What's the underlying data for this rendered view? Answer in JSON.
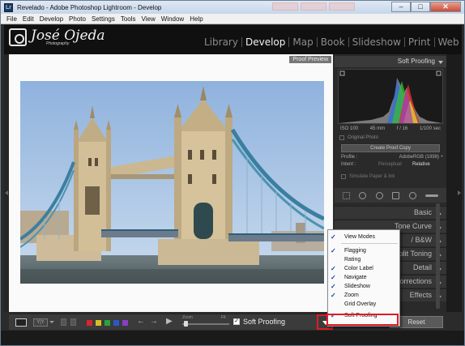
{
  "window": {
    "title": "Revelado - Adobe Photoshop Lightroom - Develop",
    "app_icon": "Lr",
    "minimize": "–",
    "maximize": "□",
    "close": "✕"
  },
  "menu": [
    "File",
    "Edit",
    "Develop",
    "Photo",
    "Settings",
    "Tools",
    "View",
    "Window",
    "Help"
  ],
  "identity": {
    "name": "José Ojeda",
    "sub": "Photography"
  },
  "modules": [
    "Library",
    "Develop",
    "Map",
    "Book",
    "Slideshow",
    "Print",
    "Web"
  ],
  "active_module": "Develop",
  "view": {
    "proof_label": "Proof Preview"
  },
  "right_panel": {
    "header": "Soft Proofing",
    "exif": [
      "ISO 100",
      "45 mm",
      "f / 16",
      "1/100 sec"
    ],
    "original_photo": "Original Photo",
    "create_button": "Create Proof Copy",
    "profile_label": "Profile :",
    "profile_value": "AdobeRGB (1998) ÷",
    "intent_label": "Intent :",
    "intent_perceptual": "Perceptual",
    "intent_relative": "Relative",
    "simulate": "Simulate Paper & Ink",
    "panels": [
      "Basic",
      "Tone Curve",
      "/ B&W",
      "Split Toning",
      "Detail",
      "Corrections",
      "Effects"
    ],
    "reset_button": "Reset"
  },
  "toolbar": {
    "yy": "Y|Y",
    "zoom_label": "Zoom",
    "fit_label": "Fit",
    "soft_proofing_label": "Soft Proofing",
    "color_labels": [
      "#d8252b",
      "#d4c020",
      "#2aa33a",
      "#2b58c7",
      "#8a3ec2"
    ],
    "nav_prev": "←",
    "nav_next": "→",
    "play": "▶"
  },
  "context_menu": {
    "items": [
      {
        "label": "View Modes",
        "checked": true
      },
      {
        "label": "Flagging",
        "checked": true
      },
      {
        "label": "Rating",
        "checked": false
      },
      {
        "label": "Color Label",
        "checked": true
      },
      {
        "label": "Navigate",
        "checked": true
      },
      {
        "label": "Slideshow",
        "checked": true
      },
      {
        "label": "Zoom",
        "checked": true
      },
      {
        "label": "Grid Overlay",
        "checked": false
      },
      {
        "label": "Soft Proofing",
        "checked": true
      }
    ]
  }
}
